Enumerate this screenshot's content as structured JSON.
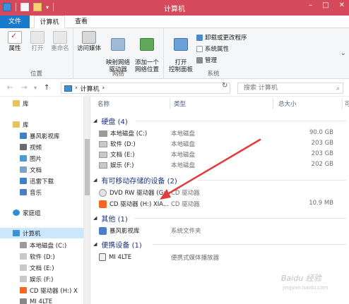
{
  "window": {
    "title": "计算机",
    "minimize": "–",
    "maximize": "□",
    "close": "✕",
    "qa_dropdown": "▾"
  },
  "tabs": {
    "file": "文件",
    "computer": "计算机",
    "view": "查看"
  },
  "ribbon": {
    "location": {
      "label": "位置",
      "properties": "属性",
      "open": "打开",
      "rename": "重命名"
    },
    "network": {
      "label": "网络",
      "access_media": "访问媒体",
      "map_drive": "映射网络\n驱动器",
      "add_location": "添加一个\n网络位置"
    },
    "system": {
      "label": "系统",
      "open_control_panel": "打开\n控制面板",
      "uninstall": "卸载或更改程序",
      "system_properties": "系统属性",
      "manage": "管理"
    },
    "expand_icon": "⌄"
  },
  "address": {
    "back": "←",
    "forward": "→",
    "dropdown": "▾",
    "up": "↑",
    "breadcrumb_sep": "›",
    "path": "计算机",
    "path_chevron": "›",
    "refresh": "↻",
    "search_placeholder": "搜索 计算机",
    "search_icon": "⌕"
  },
  "nav_pane": {
    "items": [
      {
        "label": "库",
        "icon": "library-icon",
        "color": "#e8c25c"
      },
      {
        "label": "库",
        "icon": "library-icon",
        "color": "#e8c25c"
      },
      {
        "label": "暴风影视库",
        "icon": "folder-icon",
        "color": "#3f7fc9"
      },
      {
        "label": "视频",
        "icon": "video-icon",
        "color": "#6b6b6b"
      },
      {
        "label": "图片",
        "icon": "picture-icon",
        "color": "#4a9ad4"
      },
      {
        "label": "文档",
        "icon": "document-icon",
        "color": "#7ea3c8"
      },
      {
        "label": "迅雷下载",
        "icon": "download-icon",
        "color": "#3f7fc9"
      },
      {
        "label": "音乐",
        "icon": "music-icon",
        "color": "#4a7fc8"
      },
      {
        "label": "家庭组",
        "icon": "homegroup-icon",
        "color": "#2f8fd6"
      },
      {
        "label": "计算机",
        "icon": "computer-icon",
        "color": "#3d8fd6"
      },
      {
        "label": "本地磁盘 (C:)",
        "icon": "drive-icon",
        "color": "#9a9a9a"
      },
      {
        "label": "软件 (D:)",
        "icon": "drive-icon",
        "color": "#c8c8c8"
      },
      {
        "label": "文档 (E:)",
        "icon": "drive-icon",
        "color": "#c8c8c8"
      },
      {
        "label": "娱乐 (F:)",
        "icon": "drive-icon",
        "color": "#c8c8c8"
      },
      {
        "label": "CD 驱动器 (H:) X",
        "icon": "mi-icon",
        "color": "#f26722"
      },
      {
        "label": "MI 4LTE",
        "icon": "phone-icon",
        "color": "#888888"
      }
    ]
  },
  "columns": {
    "name": "名称",
    "type": "类型",
    "total": "总大小",
    "free": "可"
  },
  "groups": {
    "hdd": "硬盘 (4)",
    "removable": "有可移动存储的设备 (2)",
    "other": "其他 (1)",
    "portable": "便携设备 (1)"
  },
  "rows": [
    {
      "name": "本地磁盘 (C:)",
      "type": "本地磁盘",
      "size": "90.0 GB",
      "icon": "drive-icon"
    },
    {
      "name": "软件 (D:)",
      "type": "本地磁盘",
      "size": "203 GB",
      "icon": "drive-icon"
    },
    {
      "name": "文档 (E:)",
      "type": "本地磁盘",
      "size": "203 GB",
      "icon": "drive-icon"
    },
    {
      "name": "娱乐 (F:)",
      "type": "本地磁盘",
      "size": "202 GB",
      "icon": "drive-icon"
    },
    {
      "name": "DVD RW 驱动器 (G:)",
      "type": "CD 驱动器",
      "size": "",
      "icon": "dvd-icon"
    },
    {
      "name": "CD 驱动器 (H:) XIA...",
      "type": "CD 驱动器",
      "size": "10.9 MB",
      "icon": "mi-icon"
    },
    {
      "name": "暴风影视库",
      "type": "系统文件夹",
      "size": "",
      "icon": "app-icon"
    },
    {
      "name": "MI 4LTE",
      "type": "便携式媒体播放器",
      "size": "",
      "icon": "phone-icon"
    }
  ],
  "annotation": {
    "arrow_color": "#e23b3b"
  },
  "watermark": {
    "line1": "Baidu 经验",
    "line2": "jingyan.baidu.com"
  },
  "colors": {
    "title_bar": "#d44a5c",
    "file_tab": "#1979ca",
    "selection": "#cce8ff",
    "group_header": "#1e3287"
  }
}
